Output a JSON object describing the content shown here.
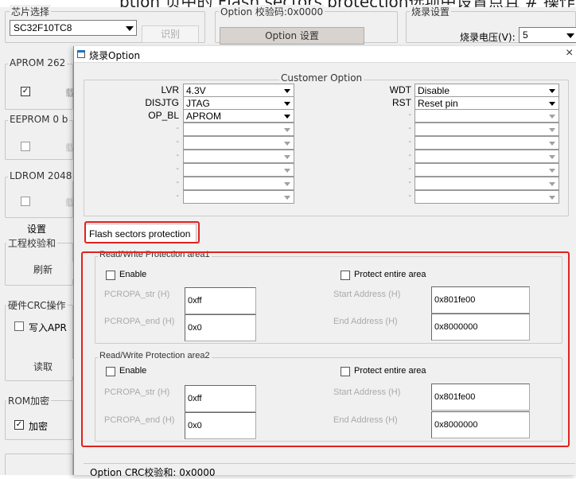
{
  "top_caption": "ption 页中的 Flash sectors protection选项中设置点且 #  操作",
  "chip_group": {
    "title": "芯片选择",
    "value": "SC32F10TC8",
    "identify_button": "识别"
  },
  "option_group": {
    "title": "Option 校验码:0x0000",
    "button": "Option 设置"
  },
  "burn_group": {
    "title": "烧录设置",
    "voltage_label": "烧录电压(V):",
    "voltage_value": "5"
  },
  "aprom_group": {
    "title": "APROM 262",
    "btn_fragment": "载"
  },
  "eeprom_group": {
    "title": "EEPROM 0 b",
    "btn_fragment": "载"
  },
  "ldrom_group": {
    "title": "LDROM 2048",
    "btn_fragment": "载"
  },
  "settings_label": "设置",
  "checksum_group": {
    "title": "工程校验和",
    "refresh_button": "刷新"
  },
  "crc_group": {
    "title": "硬件CRC操作",
    "write_checkbox": "写入APR",
    "read_button": "读取"
  },
  "rom_group": {
    "title": "ROM加密",
    "encrypt_checkbox": "加密"
  },
  "dialog": {
    "title": "烧录Option",
    "close_icon": "×",
    "customer_option_title": "Customer Option",
    "left_labels": [
      "LVR",
      "DISJTG",
      "OP_BL",
      "-",
      "-",
      "-",
      "-",
      "-",
      "-"
    ],
    "left_values": [
      "4.3V",
      "JTAG",
      "APROM",
      "",
      "",
      "",
      "",
      "",
      ""
    ],
    "right_labels": [
      "WDT",
      "RST",
      "-",
      "-",
      "-",
      "-",
      "-",
      "-",
      "-"
    ],
    "right_values": [
      "Disable",
      "Reset pin",
      "",
      "",
      "",
      "",
      "",
      "",
      ""
    ],
    "tab_label": "Flash sectors protection",
    "area1": {
      "title": "Read/Write Protection area1",
      "enable_label": "Enable",
      "protect_entire_label": "Protect entire area",
      "pcropa_str_label": "PCROPA_str  (H)",
      "pcropa_str_value": "0xff",
      "pcropa_end_label": "PCROPA_end (H)",
      "pcropa_end_value": "0x0",
      "start_addr_label": "Start Address (H)",
      "start_addr_value": "0x801fe00",
      "end_addr_label": "End Address  (H)",
      "end_addr_value": "0x8000000"
    },
    "area2": {
      "title": "Read/Write Protection area2",
      "enable_label": "Enable",
      "protect_entire_label": "Protect entire area",
      "pcropa_str_label": "PCROPA_str  (H)",
      "pcropa_str_value": "0xff",
      "pcropa_end_label": "PCROPA_end (H)",
      "pcropa_end_value": "0x0",
      "start_addr_label": "Start Address (H)",
      "start_addr_value": "0x801fe00",
      "end_addr_label": "End Address  (H)",
      "end_addr_value": "0x8000000"
    },
    "crc_footer": "Option CRC校验和:  0x0000"
  },
  "colors": {
    "highlight": "#e0231e",
    "background": "#f0f0f0"
  }
}
